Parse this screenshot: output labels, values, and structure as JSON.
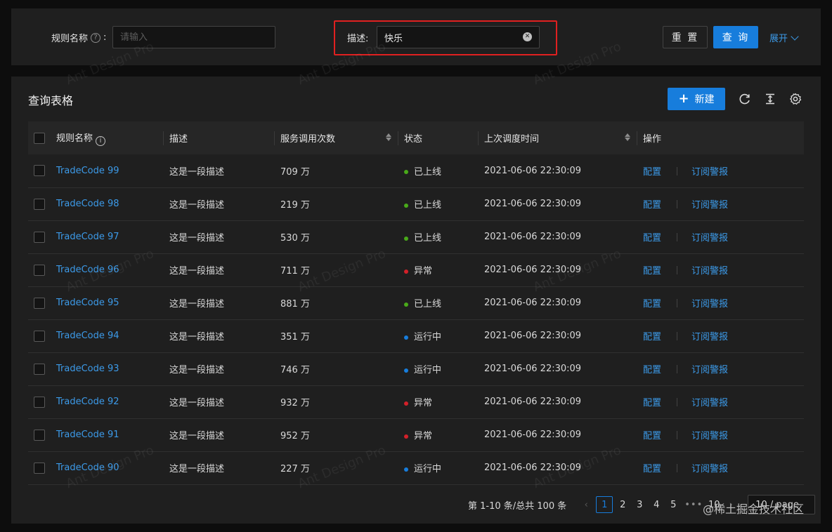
{
  "search": {
    "rule_name_label": "规则名称",
    "rule_name_placeholder": "请输入",
    "desc_label": "描述:",
    "desc_value": "快乐",
    "reset_label": "重 置",
    "query_label": "查 询",
    "expand_label": "展开"
  },
  "table_card": {
    "title": "查询表格",
    "new_label": "新建",
    "columns": {
      "name": "规则名称",
      "desc": "描述",
      "calls": "服务调用次数",
      "status": "状态",
      "time": "上次调度时间",
      "ops": "操作"
    },
    "rows": [
      {
        "name": "TradeCode 99",
        "desc": "这是一段描述",
        "calls": "709 万",
        "status": "已上线",
        "status_color": "#49aa19",
        "time": "2021-06-06 22:30:09",
        "op1": "配置",
        "op2": "订阅警报"
      },
      {
        "name": "TradeCode 98",
        "desc": "这是一段描述",
        "calls": "219 万",
        "status": "已上线",
        "status_color": "#49aa19",
        "time": "2021-06-06 22:30:09",
        "op1": "配置",
        "op2": "订阅警报"
      },
      {
        "name": "TradeCode 97",
        "desc": "这是一段描述",
        "calls": "530 万",
        "status": "已上线",
        "status_color": "#49aa19",
        "time": "2021-06-06 22:30:09",
        "op1": "配置",
        "op2": "订阅警报"
      },
      {
        "name": "TradeCode 96",
        "desc": "这是一段描述",
        "calls": "711 万",
        "status": "异常",
        "status_color": "#d32029",
        "time": "2021-06-06 22:30:09",
        "op1": "配置",
        "op2": "订阅警报"
      },
      {
        "name": "TradeCode 95",
        "desc": "这是一段描述",
        "calls": "881 万",
        "status": "已上线",
        "status_color": "#49aa19",
        "time": "2021-06-06 22:30:09",
        "op1": "配置",
        "op2": "订阅警报"
      },
      {
        "name": "TradeCode 94",
        "desc": "这是一段描述",
        "calls": "351 万",
        "status": "运行中",
        "status_color": "#177ddc",
        "time": "2021-06-06 22:30:09",
        "op1": "配置",
        "op2": "订阅警报"
      },
      {
        "name": "TradeCode 93",
        "desc": "这是一段描述",
        "calls": "746 万",
        "status": "运行中",
        "status_color": "#177ddc",
        "time": "2021-06-06 22:30:09",
        "op1": "配置",
        "op2": "订阅警报"
      },
      {
        "name": "TradeCode 92",
        "desc": "这是一段描述",
        "calls": "932 万",
        "status": "异常",
        "status_color": "#d32029",
        "time": "2021-06-06 22:30:09",
        "op1": "配置",
        "op2": "订阅警报"
      },
      {
        "name": "TradeCode 91",
        "desc": "这是一段描述",
        "calls": "952 万",
        "status": "异常",
        "status_color": "#d32029",
        "time": "2021-06-06 22:30:09",
        "op1": "配置",
        "op2": "订阅警报"
      },
      {
        "name": "TradeCode 90",
        "desc": "这是一段描述",
        "calls": "227 万",
        "status": "运行中",
        "status_color": "#177ddc",
        "time": "2021-06-06 22:30:09",
        "op1": "配置",
        "op2": "订阅警报"
      }
    ]
  },
  "pagination": {
    "total_text": "第 1-10 条/总共 100 条",
    "pages": [
      "1",
      "2",
      "3",
      "4",
      "5"
    ],
    "active_page": "1",
    "last_page": "10",
    "page_size": "10 / page"
  },
  "footer": {
    "text": "@稀土掘金技术社区"
  },
  "watermark": "Ant Design Pro",
  "colors": {
    "accent": "#177ddc",
    "link": "#3c9ae8",
    "highlight": "#e02020"
  },
  "icons": {
    "refresh": "reload-icon",
    "density": "column-height-icon",
    "settings": "setting-icon"
  }
}
